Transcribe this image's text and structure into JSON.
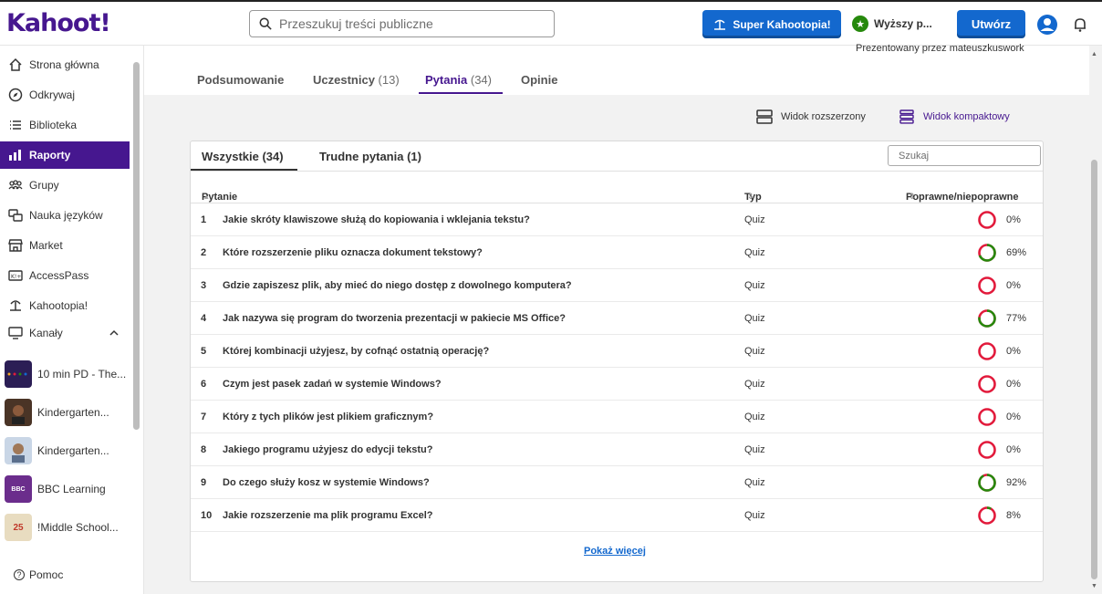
{
  "brand": {
    "logo_text": "Kahoot!"
  },
  "header": {
    "search_placeholder": "Przeszukuj treści publiczne",
    "super_button": "Super Kahootopia!",
    "upgrade_label": "Wyższy p...",
    "create_button": "Utwórz"
  },
  "sidebar": {
    "items": [
      {
        "label": "Strona główna",
        "icon": "home-icon"
      },
      {
        "label": "Odkrywaj",
        "icon": "compass-icon"
      },
      {
        "label": "Biblioteka",
        "icon": "list-icon"
      },
      {
        "label": "Raporty",
        "icon": "bar-chart-icon",
        "active": true
      },
      {
        "label": "Grupy",
        "icon": "group-icon"
      },
      {
        "label": "Nauka języków",
        "icon": "language-icon"
      },
      {
        "label": "Market",
        "icon": "store-icon"
      },
      {
        "label": "AccessPass",
        "icon": "ticket-icon"
      },
      {
        "label": "Kahootopia!",
        "icon": "island-icon"
      }
    ],
    "channels_label": "Kanały",
    "channels": [
      {
        "label": "10 min PD - The...",
        "color": "#3a2a6e"
      },
      {
        "label": "Kindergarten...",
        "color": "#5a3a2a"
      },
      {
        "label": "Kindergarten...",
        "color": "#7a8aa0"
      },
      {
        "label": "BBC Learning",
        "color": "#6b2d8c",
        "thumb_text": "BBC"
      },
      {
        "label": "!Middle School...",
        "color": "#d8c9a6",
        "thumb_text": "25"
      }
    ],
    "help_label": "Pomoc"
  },
  "report": {
    "presenter": "Prezentowany przez mateuszkuswork",
    "tabs": [
      {
        "label": "Podsumowanie",
        "count": ""
      },
      {
        "label": "Uczestnicy",
        "count": "(13)"
      },
      {
        "label": "Pytania",
        "count": "(34)",
        "active": true
      },
      {
        "label": "Opinie",
        "count": ""
      }
    ],
    "view_expanded": "Widok rozszerzony",
    "view_compact": "Widok kompaktowy",
    "subtabs": [
      "Wszystkie (34)",
      "Trudne pytania (1)"
    ],
    "filter_placeholder": "Szukaj",
    "columns": {
      "question": "Pytanie",
      "type": "Typ",
      "correct": "Poprawne/niepoprawne"
    },
    "rows": [
      {
        "num": "1",
        "question": "Jakie skróty klawiszowe służą do kopiowania i wklejania tekstu?",
        "type": "Quiz",
        "pct": "0%",
        "value": 0
      },
      {
        "num": "2",
        "question": "Które rozszerzenie pliku oznacza dokument tekstowy?",
        "type": "Quiz",
        "pct": "69%",
        "value": 69
      },
      {
        "num": "3",
        "question": "Gdzie zapiszesz plik, aby mieć do niego dostęp z dowolnego komputera?",
        "type": "Quiz",
        "pct": "0%",
        "value": 0
      },
      {
        "num": "4",
        "question": "Jak nazywa się program do tworzenia prezentacji w pakiecie MS Office?",
        "type": "Quiz",
        "pct": "77%",
        "value": 77
      },
      {
        "num": "5",
        "question": "Której kombinacji użyjesz, by cofnąć ostatnią operację?",
        "type": "Quiz",
        "pct": "0%",
        "value": 0
      },
      {
        "num": "6",
        "question": "Czym jest pasek zadań w systemie Windows?",
        "type": "Quiz",
        "pct": "0%",
        "value": 0
      },
      {
        "num": "7",
        "question": "Który z tych plików jest plikiem graficznym?",
        "type": "Quiz",
        "pct": "0%",
        "value": 0
      },
      {
        "num": "8",
        "question": "Jakiego programu użyjesz do edycji tekstu?",
        "type": "Quiz",
        "pct": "0%",
        "value": 0
      },
      {
        "num": "9",
        "question": "Do czego służy kosz w systemie Windows?",
        "type": "Quiz",
        "pct": "92%",
        "value": 92
      },
      {
        "num": "10",
        "question": "Jakie rozszerzenie ma plik programu Excel?",
        "type": "Quiz",
        "pct": "8%",
        "value": 8
      }
    ],
    "show_more": "Pokaż więcej"
  },
  "colors": {
    "brand": "#46178f",
    "blue": "#1368ce",
    "correct": "#26890c",
    "incorrect": "#e21b3c"
  }
}
